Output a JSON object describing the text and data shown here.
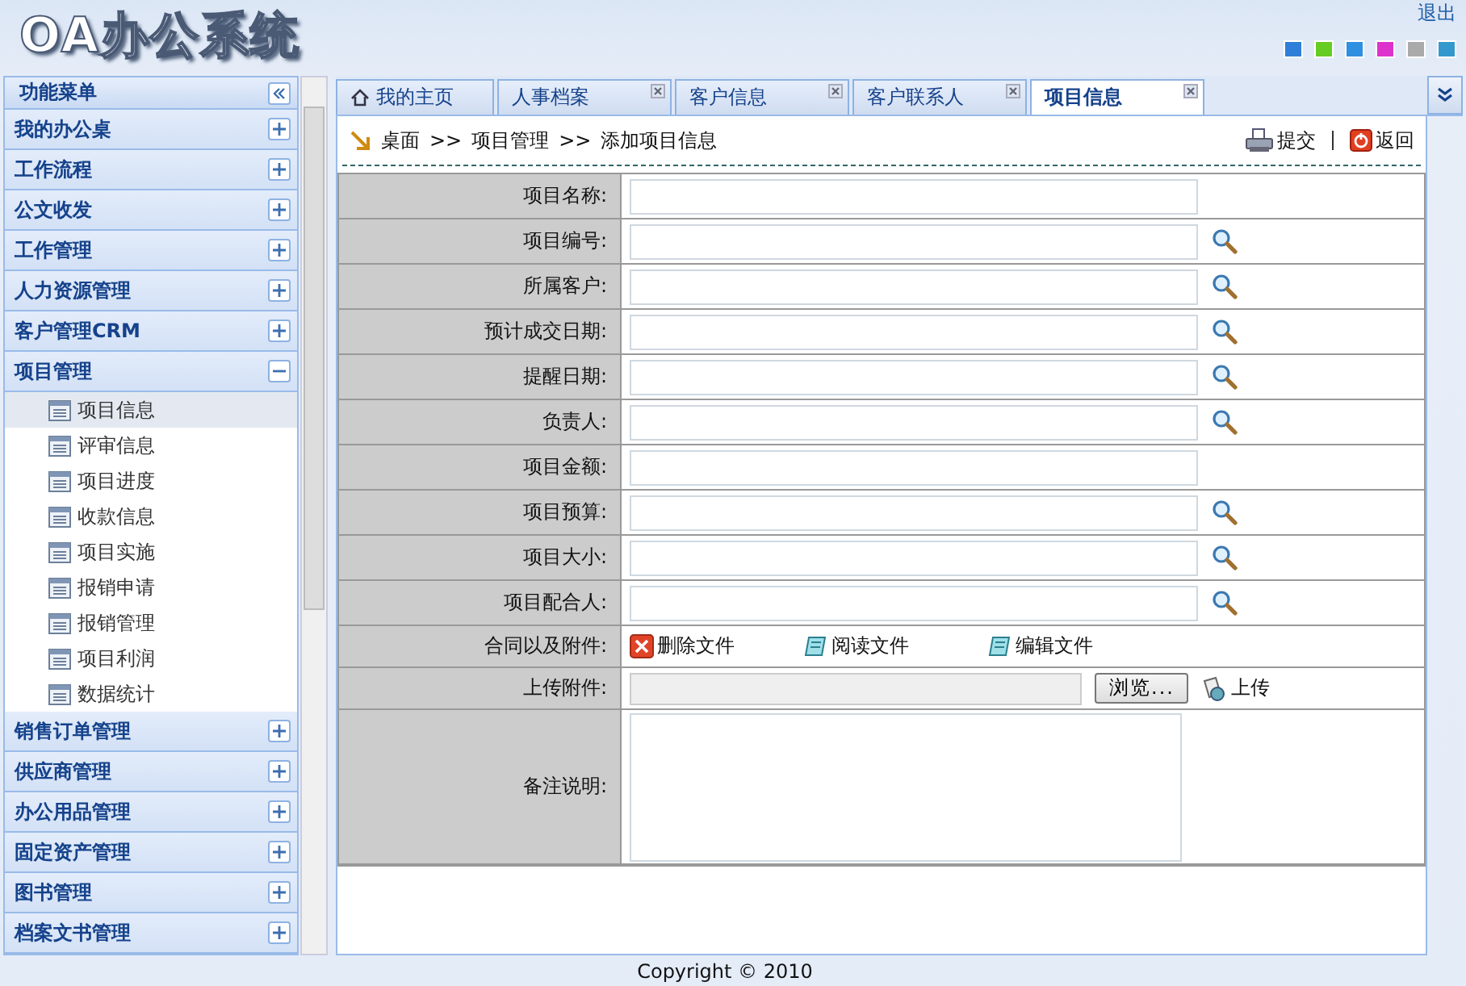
{
  "header": {
    "title": "OA办公系统",
    "logout": "退出",
    "themes": [
      {
        "color": "#2f7fd8"
      },
      {
        "color": "#66cc22"
      },
      {
        "color": "#2f8fe0"
      },
      {
        "color": "#dd33cc"
      },
      {
        "color": "#aaaaaa"
      },
      {
        "color": "#3399cc"
      }
    ]
  },
  "sidebar": {
    "title": "功能菜单",
    "groups": [
      {
        "label": "我的办公桌",
        "expanded": false
      },
      {
        "label": "工作流程",
        "expanded": false
      },
      {
        "label": "公文收发",
        "expanded": false
      },
      {
        "label": "工作管理",
        "expanded": false
      },
      {
        "label": "人力资源管理",
        "expanded": false
      },
      {
        "label": "客户管理CRM",
        "expanded": false
      },
      {
        "label": "项目管理",
        "expanded": true,
        "children": [
          {
            "label": "项目信息",
            "selected": true
          },
          {
            "label": "评审信息",
            "selected": false
          },
          {
            "label": "项目进度",
            "selected": false
          },
          {
            "label": "收款信息",
            "selected": false
          },
          {
            "label": "项目实施",
            "selected": false
          },
          {
            "label": "报销申请",
            "selected": false
          },
          {
            "label": "报销管理",
            "selected": false
          },
          {
            "label": "项目利润",
            "selected": false
          },
          {
            "label": "数据统计",
            "selected": false
          }
        ]
      },
      {
        "label": "销售订单管理",
        "expanded": false
      },
      {
        "label": "供应商管理",
        "expanded": false
      },
      {
        "label": "办公用品管理",
        "expanded": false
      },
      {
        "label": "固定资产管理",
        "expanded": false
      },
      {
        "label": "图书管理",
        "expanded": false
      },
      {
        "label": "档案文书管理",
        "expanded": false
      }
    ]
  },
  "tabs": [
    {
      "label": "我的主页",
      "selected": false,
      "closable": false
    },
    {
      "label": "人事档案",
      "selected": false,
      "closable": true
    },
    {
      "label": "客户信息",
      "selected": false,
      "closable": true
    },
    {
      "label": "客户联系人",
      "selected": false,
      "closable": true
    },
    {
      "label": "项目信息",
      "selected": true,
      "closable": true
    }
  ],
  "breadcrumb": [
    "桌面",
    ">>",
    "项目管理",
    ">>",
    "添加项目信息"
  ],
  "actions": [
    {
      "kind": "submit",
      "label": "提交"
    },
    {
      "kind": "back",
      "label": "返回"
    }
  ],
  "form": {
    "fields": [
      {
        "kind": "text",
        "label": "项目名称:"
      },
      {
        "kind": "lookup",
        "label": "项目编号:"
      },
      {
        "kind": "lookup",
        "label": "所属客户:"
      },
      {
        "kind": "lookup",
        "label": "预计成交日期:"
      },
      {
        "kind": "lookup",
        "label": "提醒日期:"
      },
      {
        "kind": "lookup",
        "label": "负责人:"
      },
      {
        "kind": "text",
        "label": "项目金额:"
      },
      {
        "kind": "lookup",
        "label": "项目预算:"
      },
      {
        "kind": "lookup",
        "label": "项目大小:"
      },
      {
        "kind": "lookup",
        "label": "项目配合人:"
      },
      {
        "kind": "files",
        "label": "合同以及附件:",
        "buttons": [
          {
            "kind": "delete",
            "label": "删除文件"
          },
          {
            "kind": "read",
            "label": "阅读文件"
          },
          {
            "kind": "edit",
            "label": "编辑文件"
          }
        ]
      },
      {
        "kind": "upload",
        "label": "上传附件:",
        "browse": "浏览...",
        "upload": "上传"
      },
      {
        "kind": "textarea",
        "label": "备注说明:"
      }
    ]
  },
  "footer": "Copyright © 2010"
}
